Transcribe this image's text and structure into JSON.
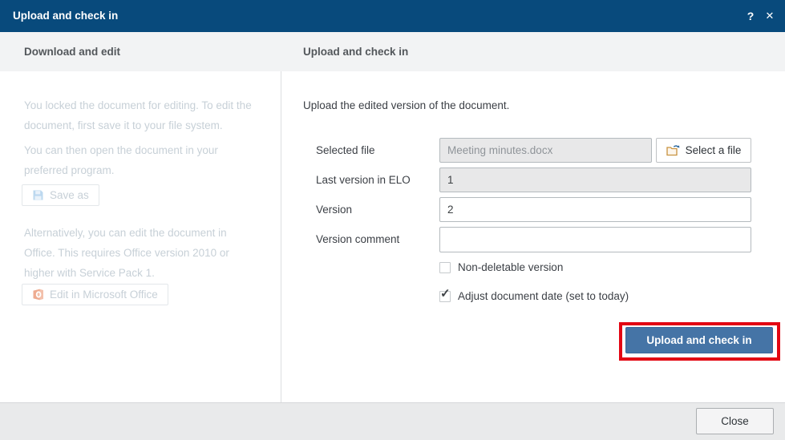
{
  "window": {
    "title": "Upload and check in"
  },
  "icons": {
    "help": "?",
    "close": "✕",
    "check": "✓"
  },
  "left_panel": {
    "header": "Download and edit",
    "para1": [
      "You locked the document for editing. To edit the",
      "document, first save it to your file system."
    ],
    "para2": [
      "You can then open the document in your",
      "preferred program."
    ],
    "save_as_button": "Save as",
    "para3": [
      "Alternatively, you can edit the document in",
      "Office. This requires Office version 2010 or",
      "higher with Service Pack 1."
    ],
    "edit_office_button": "Edit in Microsoft Office"
  },
  "right_panel": {
    "header": "Upload and check in",
    "intro": "Upload the edited version of the document.",
    "select_file_button": "Select a file",
    "fields": [
      {
        "label": "Selected file",
        "value": "Meeting minutes.docx",
        "disabled": true
      },
      {
        "label": "Last version in ELO",
        "value": "1",
        "disabled": true
      },
      {
        "label": "Version",
        "value": "2",
        "disabled": false
      },
      {
        "label": "Version comment",
        "value": "",
        "disabled": false
      }
    ],
    "checkboxes": [
      {
        "label": "Non-deletable version",
        "checked": false
      },
      {
        "label": "Adjust document date (set to today)",
        "checked": true
      }
    ],
    "upload_button": "Upload and check in"
  },
  "footer": {
    "close_button": "Close"
  },
  "colors": {
    "titlebar_bg": "#084a7c",
    "primary_button_bg": "#4574a6",
    "annotation_red": "#e30613",
    "disabled_text": "#c7d0d7"
  }
}
